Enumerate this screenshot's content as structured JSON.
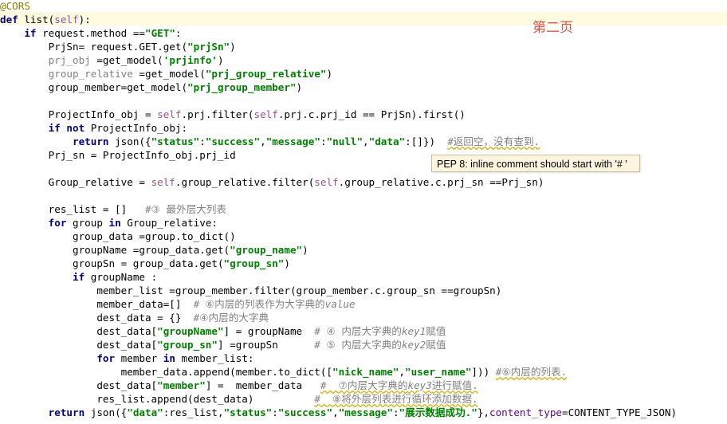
{
  "editor": {
    "page_label": "第二页",
    "tooltip": "PEP 8: inline comment should start with '# '",
    "lines": [
      [
        {
          "t": "@CORS",
          "c": "dec"
        }
      ],
      [
        {
          "t": "def ",
          "c": "kw"
        },
        {
          "t": "list("
        },
        {
          "t": "self",
          "c": "self"
        },
        {
          "t": "):"
        }
      ],
      [
        {
          "t": "    "
        },
        {
          "t": "if ",
          "c": "kw"
        },
        {
          "t": "request.method ==",
          "c": ""
        },
        {
          "t": "\"GET\"",
          "c": "str"
        },
        {
          "t": ":"
        }
      ],
      [
        {
          "t": "        PrjSn= request.GET.get("
        },
        {
          "t": "\"prjSn\"",
          "c": "str"
        },
        {
          "t": ")"
        }
      ],
      [
        {
          "t": "        "
        },
        {
          "t": "prj_obj",
          "c": "grey"
        },
        {
          "t": " =get_model("
        },
        {
          "t": "'prjinfo'",
          "c": "str"
        },
        {
          "t": ")"
        }
      ],
      [
        {
          "t": "        "
        },
        {
          "t": "group_relative",
          "c": "grey"
        },
        {
          "t": " =get_model("
        },
        {
          "t": "\"prj_group_relative\"",
          "c": "str"
        },
        {
          "t": ")"
        }
      ],
      [
        {
          "t": "        group_member=get_model("
        },
        {
          "t": "\"prj_group_member\"",
          "c": "str"
        },
        {
          "t": ")"
        }
      ],
      [
        {
          "t": ""
        }
      ],
      [
        {
          "t": "        ProjectInfo_obj = "
        },
        {
          "t": "self",
          "c": "self"
        },
        {
          "t": ".prj.filter("
        },
        {
          "t": "self",
          "c": "self"
        },
        {
          "t": ".prj.c.prj_id == PrjSn).first()"
        }
      ],
      [
        {
          "t": "        "
        },
        {
          "t": "if not ",
          "c": "kw"
        },
        {
          "t": "ProjectInfo_obj:"
        }
      ],
      [
        {
          "t": "            "
        },
        {
          "t": "return ",
          "c": "kw"
        },
        {
          "t": "json({"
        },
        {
          "t": "\"status\"",
          "c": "str"
        },
        {
          "t": ":"
        },
        {
          "t": "\"success\"",
          "c": "str"
        },
        {
          "t": ","
        },
        {
          "t": "\"message\"",
          "c": "str"
        },
        {
          "t": ":"
        },
        {
          "t": "\"null\"",
          "c": "str"
        },
        {
          "t": ","
        },
        {
          "t": "\"data\"",
          "c": "str"
        },
        {
          "t": ":[]})  "
        },
        {
          "t": "#返回空，没有查到.",
          "c": "cm squiggle"
        }
      ],
      [
        {
          "t": "        Prj_sn = ProjectInfo_obj.prj_id"
        }
      ],
      [
        {
          "t": ""
        }
      ],
      [
        {
          "t": "        Group_relative = "
        },
        {
          "t": "self",
          "c": "self"
        },
        {
          "t": ".group_relative.filter("
        },
        {
          "t": "self",
          "c": "self"
        },
        {
          "t": ".group_relative.c.prj_sn ==Prj_sn)"
        }
      ],
      [
        {
          "t": ""
        }
      ],
      [
        {
          "t": "        res_list = []   "
        },
        {
          "t": "#③ 最外层大列表",
          "c": "cm"
        }
      ],
      [
        {
          "t": "        "
        },
        {
          "t": "for ",
          "c": "kw"
        },
        {
          "t": "group "
        },
        {
          "t": "in ",
          "c": "kw"
        },
        {
          "t": "Group_relative:"
        }
      ],
      [
        {
          "t": "            group_data =group.to_dict()"
        }
      ],
      [
        {
          "t": "            groupName =group_data.get("
        },
        {
          "t": "\"group_name\"",
          "c": "str"
        },
        {
          "t": ")"
        }
      ],
      [
        {
          "t": "            groupSn = group_data.get("
        },
        {
          "t": "\"group_sn\"",
          "c": "str"
        },
        {
          "t": ")"
        }
      ],
      [
        {
          "t": "            "
        },
        {
          "t": "if ",
          "c": "kw"
        },
        {
          "t": "groupName :"
        }
      ],
      [
        {
          "t": "                member_list =group_member.filter(group_member.c.group_sn ==groupSn)"
        }
      ],
      [
        {
          "t": "                member_data=[]  "
        },
        {
          "t": "# ⑥内层的列表作为大字典的",
          "c": "cm"
        },
        {
          "t": "value",
          "c": "cm-i"
        }
      ],
      [
        {
          "t": "                dest_data = {}  "
        },
        {
          "t": "#④内层的大字典",
          "c": "cm"
        }
      ],
      [
        {
          "t": "                dest_data["
        },
        {
          "t": "\"groupName\"",
          "c": "str"
        },
        {
          "t": "] = groupName  "
        },
        {
          "t": "# ④ 内层大字典的",
          "c": "cm"
        },
        {
          "t": "key1",
          "c": "cm-i"
        },
        {
          "t": "赋值",
          "c": "cm"
        }
      ],
      [
        {
          "t": "                dest_data["
        },
        {
          "t": "\"group_sn\"",
          "c": "str"
        },
        {
          "t": "] =groupSn      "
        },
        {
          "t": "# ⑤ 内层大字典的",
          "c": "cm"
        },
        {
          "t": "key2",
          "c": "cm-i"
        },
        {
          "t": "赋值",
          "c": "cm"
        }
      ],
      [
        {
          "t": "                "
        },
        {
          "t": "for ",
          "c": "kw"
        },
        {
          "t": "member "
        },
        {
          "t": "in ",
          "c": "kw"
        },
        {
          "t": "member_list:"
        }
      ],
      [
        {
          "t": "                    member_data.append(member.to_dict(["
        },
        {
          "t": "\"nick_name\"",
          "c": "str"
        },
        {
          "t": ","
        },
        {
          "t": "\"user_name\"",
          "c": "str"
        },
        {
          "t": "])) "
        },
        {
          "t": "#⑥内层的列表.",
          "c": "cm squiggle"
        }
      ],
      [
        {
          "t": "                dest_data["
        },
        {
          "t": "\"member\"",
          "c": "str"
        },
        {
          "t": "] =  member_data   "
        },
        {
          "t": "#  ⑦内层大字典的",
          "c": "cm squiggle"
        },
        {
          "t": "key3",
          "c": "cm-i squiggle"
        },
        {
          "t": "进行赋值.",
          "c": "cm squiggle"
        }
      ],
      [
        {
          "t": "                res_list.append(dest_data)          "
        },
        {
          "t": "#  ⑧将外层列表进行循环添加数据.",
          "c": "cm squiggle"
        }
      ],
      [
        {
          "t": "        "
        },
        {
          "t": "return ",
          "c": "kw"
        },
        {
          "t": "json({"
        },
        {
          "t": "\"data\"",
          "c": "str"
        },
        {
          "t": ":res_list,"
        },
        {
          "t": "\"status\"",
          "c": "str"
        },
        {
          "t": ":"
        },
        {
          "t": "\"success\"",
          "c": "str"
        },
        {
          "t": ","
        },
        {
          "t": "\"message\"",
          "c": "str"
        },
        {
          "t": ":"
        },
        {
          "t": "\"展示数据成功.\"",
          "c": "str"
        },
        {
          "t": "},"
        },
        {
          "t": "content_type",
          "c": "kwarg"
        },
        {
          "t": "=CONTENT_TYPE_JSON)"
        }
      ]
    ]
  }
}
